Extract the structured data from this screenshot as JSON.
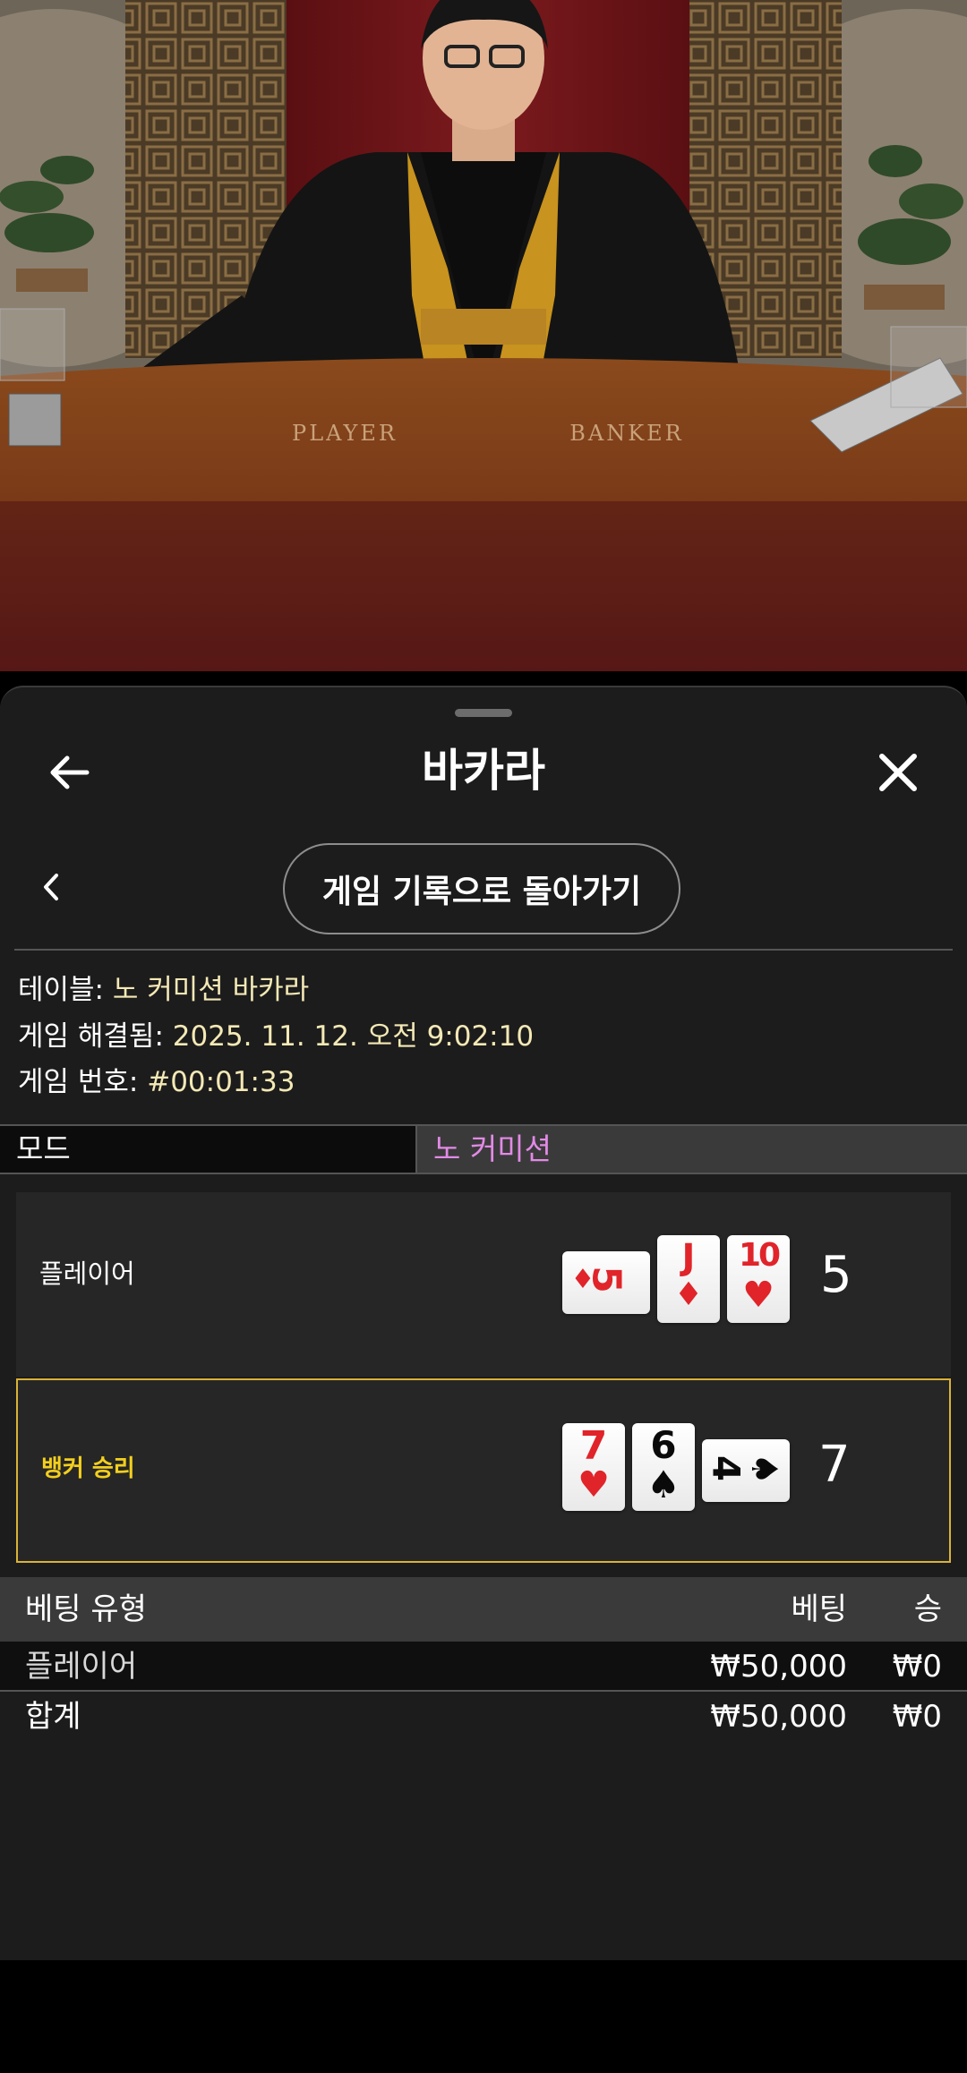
{
  "header": {
    "title": "바카라",
    "back_icon": "arrow-left-icon",
    "close_icon": "close-icon"
  },
  "nav": {
    "prev_icon": "chevron-left-icon",
    "history_button": "게임 기록으로 돌아가기"
  },
  "info": {
    "table_label": "테이블: ",
    "table_value": "노 커미션 바카라",
    "resolved_label": "게임 해결됨: ",
    "resolved_value": "2025. 11. 12. 오전 9:02:10",
    "number_label": "게임 번호: ",
    "number_value": "#00:01:33"
  },
  "mode": {
    "label": "모드",
    "value": "노 커미션"
  },
  "table_felt": {
    "player_text": "PLAYER",
    "banker_text": "BANKER"
  },
  "hands": {
    "player": {
      "label": "플레이어",
      "score": "5",
      "cards": [
        {
          "rank": "5",
          "suit": "♦",
          "color": "#e0242a",
          "rotated": true
        },
        {
          "rank": "J",
          "suit": "♦",
          "color": "#e0242a",
          "rotated": false
        },
        {
          "rank": "10",
          "suit": "♥",
          "color": "#e0242a",
          "rotated": false
        }
      ]
    },
    "banker": {
      "label": "뱅커 승리",
      "score": "7",
      "cards": [
        {
          "rank": "7",
          "suit": "♥",
          "color": "#e0242a",
          "rotated": false
        },
        {
          "rank": "6",
          "suit": "♠",
          "color": "#0a0a0a",
          "rotated": false
        },
        {
          "rank": "4",
          "suit": "♠",
          "color": "#0a0a0a",
          "rotated": true
        }
      ]
    }
  },
  "bets": {
    "headers": {
      "type": "베팅 유형",
      "bet": "베팅",
      "win": "승"
    },
    "rows": [
      {
        "type": "플레이어",
        "bet": "₩50,000",
        "win": "₩0"
      }
    ],
    "total": {
      "type": "합계",
      "bet": "₩50,000",
      "win": "₩0"
    }
  },
  "colors": {
    "accent_mode": "#e28ae6",
    "winner_border": "#d9b236",
    "winner_text": "#f3cf1e",
    "info_value": "#f4e9b5"
  }
}
